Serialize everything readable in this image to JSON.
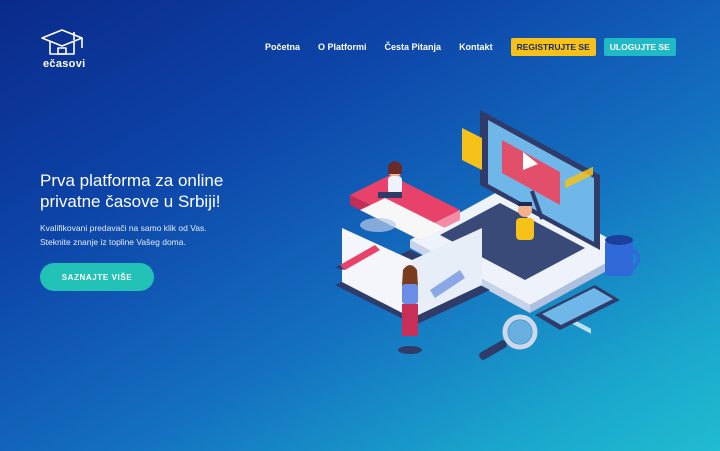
{
  "brand": {
    "name": "ečasovi"
  },
  "nav": {
    "links": [
      "Početna",
      "O Platformi",
      "Česta Pitanja",
      "Kontakt"
    ],
    "register_label": "REGISTRUJTE SE",
    "login_label": "ULOGUJTE SE"
  },
  "hero": {
    "title": "Prva platforma za online privatne časove u Srbiji!",
    "subtitle_line1": "Kvalifikovani predavači na samo klik od Vas.",
    "subtitle_line2": "Steknite znanje iz topline Vašeg doma.",
    "cta_label": "SAZNAJTE VIŠE"
  },
  "colors": {
    "accent_yellow": "#f6c21a",
    "accent_teal": "#22b9c6",
    "cta_green": "#23c2b6"
  },
  "icons": [
    "graduation-cap-house-icon"
  ]
}
